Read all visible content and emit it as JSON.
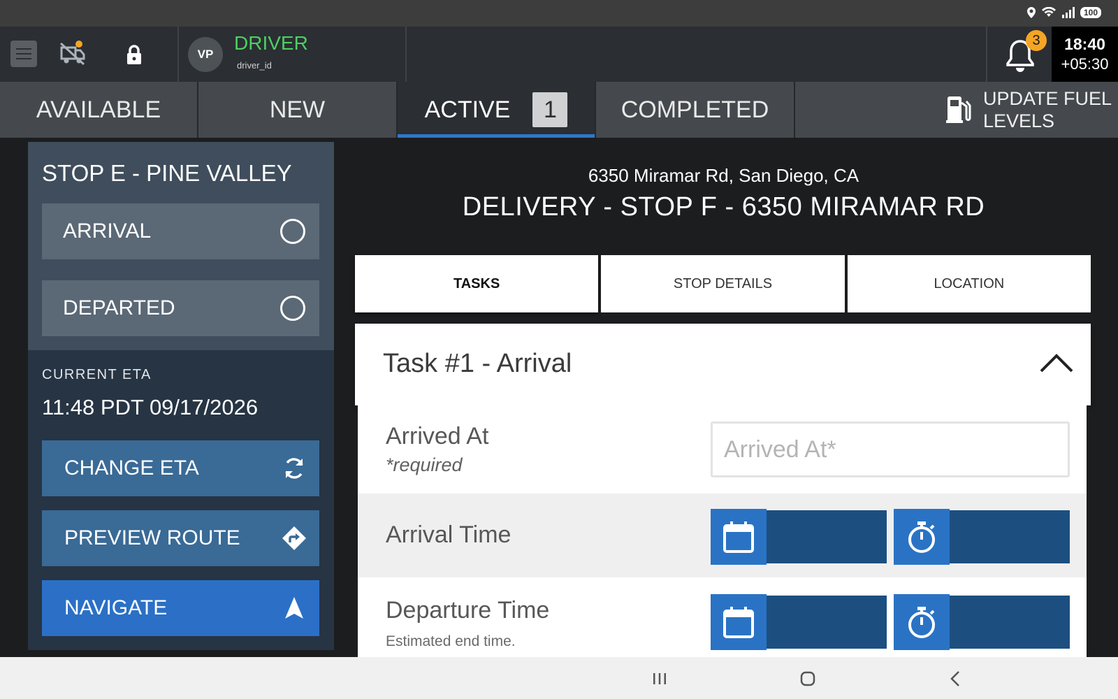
{
  "status_bar": {
    "battery": "100"
  },
  "header": {
    "avatar_initials": "VP",
    "role": "DRIVER",
    "driver_id": "driver_id",
    "notification_count": "3",
    "time": "18:40",
    "timezone": "+05:30"
  },
  "tabs": {
    "available": "AVAILABLE",
    "new": "NEW",
    "active": "ACTIVE",
    "active_count": "1",
    "completed": "COMPLETED",
    "fuel_line1": "UPDATE FUEL",
    "fuel_line2": "LEVELS"
  },
  "stop": {
    "title": "STOP E - PINE VALLEY",
    "arrival": "ARRIVAL",
    "departed": "DEPARTED",
    "eta_label": "CURRENT ETA",
    "eta_value": "11:48 PDT 09/17/2026",
    "change_eta": "CHANGE ETA",
    "preview_route": "PREVIEW ROUTE",
    "navigate": "NAVIGATE"
  },
  "delivery": {
    "address": "6350 Miramar Rd, San Diego, CA",
    "heading": "DELIVERY - STOP F - 6350 MIRAMAR RD"
  },
  "subtabs": {
    "tasks": "TASKS",
    "stop_details": "STOP DETAILS",
    "location": "LOCATION"
  },
  "task": {
    "title": "Task #1 - Arrival",
    "arrived_at_label": "Arrived At",
    "arrived_at_required": "*required",
    "arrived_at_placeholder": "Arrived At*",
    "arrival_time_label": "Arrival Time",
    "departure_time_label": "Departure Time",
    "departure_time_hint": "Estimated end time."
  },
  "colors": {
    "accent_blue": "#2b70c6",
    "driver_green": "#4cd060",
    "badge_orange": "#f5a524"
  }
}
